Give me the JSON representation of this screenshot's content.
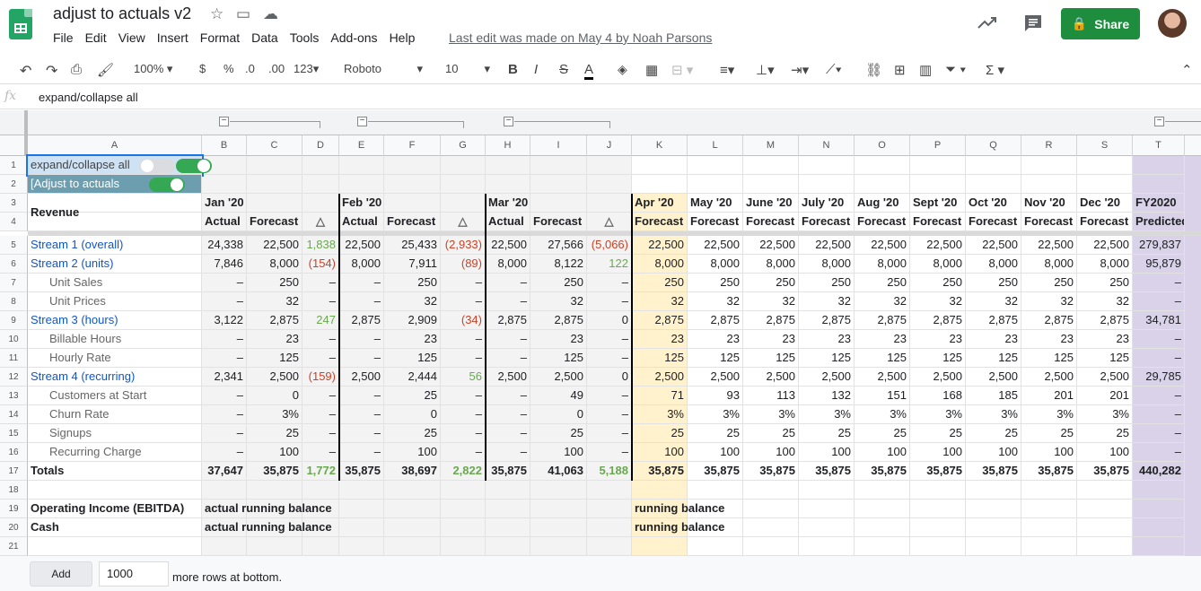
{
  "doc": {
    "title": "adjust to actuals v2",
    "last_edit": "Last edit was made on May 4 by Noah Parsons",
    "share_label": "Share"
  },
  "menu": [
    "File",
    "Edit",
    "View",
    "Insert",
    "Format",
    "Data",
    "Tools",
    "Add-ons",
    "Help"
  ],
  "toolbar": {
    "zoom": "100%",
    "currency": "$",
    "percent": "%",
    "dec_less": ".0",
    "dec_more": ".00",
    "format": "123",
    "font": "Roboto",
    "size": "10",
    "bold": "B",
    "italic": "I",
    "strike": "S",
    "textcolor": "A"
  },
  "formula": {
    "fx": "fx",
    "value": "expand/collapse all"
  },
  "columns": [
    "A",
    "B",
    "C",
    "D",
    "E",
    "F",
    "G",
    "H",
    "I",
    "J",
    "K",
    "L",
    "M",
    "N",
    "O",
    "P",
    "Q",
    "R",
    "S",
    "T"
  ],
  "rows": [
    "1",
    "2",
    "3",
    "4",
    "5",
    "6",
    "7",
    "8",
    "9",
    "10",
    "11",
    "12",
    "13",
    "14",
    "15",
    "16",
    "17",
    "18",
    "19",
    "20",
    "21"
  ],
  "cells": {
    "r1": {
      "a": "expand/collapse all"
    },
    "r2": {
      "a": "[Adjust to actuals"
    },
    "r3": {
      "revenue": "Revenue",
      "b": "Jan '20",
      "e": "Feb '20",
      "h": "Mar '20",
      "k": "Apr '20",
      "l": "May '20",
      "m": "June '20",
      "n": "July '20",
      "o": "Aug '20",
      "p": "Sept '20",
      "q": "Oct '20",
      "r": "Nov '20",
      "s": "Dec '20",
      "t": "FY2020"
    },
    "r4": {
      "b": "Actual",
      "c": "Forecast",
      "d": "△",
      "e": "Actual",
      "f": "Forecast",
      "g": "△",
      "h": "Actual",
      "i": "Forecast",
      "j": "△",
      "k": "Forecast",
      "l": "Forecast",
      "m": "Forecast",
      "n": "Forecast",
      "o": "Forecast",
      "p": "Forecast",
      "q": "Forecast",
      "r": "Forecast",
      "s": "Forecast",
      "t": "Predicted"
    },
    "body": [
      [
        "Stream 1 (overall)",
        "24,338",
        "22,500",
        "1,838",
        "22,500",
        "25,433",
        "(2,933)",
        "22,500",
        "27,566",
        "(5,066)",
        "22,500",
        "22,500",
        "22,500",
        "22,500",
        "22,500",
        "22,500",
        "22,500",
        "22,500",
        "22,500",
        "279,837"
      ],
      [
        "Stream 2 (units)",
        "7,846",
        "8,000",
        "(154)",
        "8,000",
        "7,911",
        "(89)",
        "8,000",
        "8,122",
        "122",
        "8,000",
        "8,000",
        "8,000",
        "8,000",
        "8,000",
        "8,000",
        "8,000",
        "8,000",
        "8,000",
        "95,879"
      ],
      [
        "Unit Sales",
        "–",
        "250",
        "–",
        "–",
        "250",
        "–",
        "–",
        "250",
        "–",
        "250",
        "250",
        "250",
        "250",
        "250",
        "250",
        "250",
        "250",
        "250",
        "–"
      ],
      [
        "Unit Prices",
        "–",
        "32",
        "–",
        "–",
        "32",
        "–",
        "–",
        "32",
        "–",
        "32",
        "32",
        "32",
        "32",
        "32",
        "32",
        "32",
        "32",
        "32",
        "–"
      ],
      [
        "Stream 3 (hours)",
        "3,122",
        "2,875",
        "247",
        "2,875",
        "2,909",
        "(34)",
        "2,875",
        "2,875",
        "0",
        "2,875",
        "2,875",
        "2,875",
        "2,875",
        "2,875",
        "2,875",
        "2,875",
        "2,875",
        "2,875",
        "34,781"
      ],
      [
        "Billable Hours",
        "–",
        "23",
        "–",
        "–",
        "23",
        "–",
        "–",
        "23",
        "–",
        "23",
        "23",
        "23",
        "23",
        "23",
        "23",
        "23",
        "23",
        "23",
        "–"
      ],
      [
        "Hourly Rate",
        "–",
        "125",
        "–",
        "–",
        "125",
        "–",
        "–",
        "125",
        "–",
        "125",
        "125",
        "125",
        "125",
        "125",
        "125",
        "125",
        "125",
        "125",
        "–"
      ],
      [
        "Stream 4 (recurring)",
        "2,341",
        "2,500",
        "(159)",
        "2,500",
        "2,444",
        "56",
        "2,500",
        "2,500",
        "0",
        "2,500",
        "2,500",
        "2,500",
        "2,500",
        "2,500",
        "2,500",
        "2,500",
        "2,500",
        "2,500",
        "29,785"
      ],
      [
        "Customers at Start",
        "–",
        "0",
        "–",
        "–",
        "25",
        "–",
        "–",
        "49",
        "–",
        "71",
        "93",
        "113",
        "132",
        "151",
        "168",
        "185",
        "201",
        "201",
        "–"
      ],
      [
        "Churn Rate",
        "–",
        "3%",
        "–",
        "–",
        "0",
        "–",
        "–",
        "0",
        "–",
        "3%",
        "3%",
        "3%",
        "3%",
        "3%",
        "3%",
        "3%",
        "3%",
        "3%",
        "–"
      ],
      [
        "Signups",
        "–",
        "25",
        "–",
        "–",
        "25",
        "–",
        "–",
        "25",
        "–",
        "25",
        "25",
        "25",
        "25",
        "25",
        "25",
        "25",
        "25",
        "25",
        "–"
      ],
      [
        "Recurring Charge",
        "–",
        "100",
        "–",
        "–",
        "100",
        "–",
        "–",
        "100",
        "–",
        "100",
        "100",
        "100",
        "100",
        "100",
        "100",
        "100",
        "100",
        "100",
        "–"
      ],
      [
        "Totals",
        "37,647",
        "35,875",
        "1,772",
        "35,875",
        "38,697",
        "2,822",
        "35,875",
        "41,063",
        "5,188",
        "35,875",
        "35,875",
        "35,875",
        "35,875",
        "35,875",
        "35,875",
        "35,875",
        "35,875",
        "35,875",
        "440,282"
      ]
    ],
    "r19": {
      "a": "Operating Income (EBITDA)",
      "b": "actual running balance",
      "k": "running balance"
    },
    "r20": {
      "a": "Cash",
      "b": "actual running balance",
      "k": "running balance"
    }
  },
  "bottom": {
    "add": "Add",
    "rows": "1000",
    "more": "more rows at bottom."
  },
  "colors": {
    "accent": "#1e8e3e",
    "highlight": "#fff2cc",
    "predicted": "#d9d2e9",
    "negative": "#cc4125",
    "positive": "#6aa84f",
    "link": "#1155cc"
  }
}
